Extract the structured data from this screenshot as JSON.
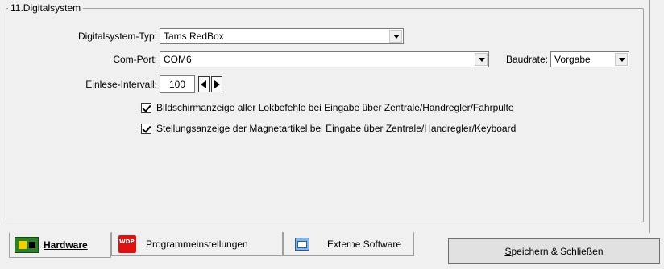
{
  "groupbox": {
    "title": "11.Digitalsystem"
  },
  "fields": {
    "digitalsystem_label": "Digitalsystem-Typ:",
    "digitalsystem_value": "Tams RedBox",
    "comport_label": "Com-Port:",
    "comport_value": "COM6",
    "baudrate_label": "Baudrate:",
    "baudrate_value": "Vorgabe",
    "interval_label": "Einlese-Intervall:",
    "interval_value": "100"
  },
  "checkboxes": [
    {
      "label": "Bildschirmanzeige aller Lokbefehle bei Eingabe über Zentrale/Handregler/Fahrpulte",
      "checked": true
    },
    {
      "label": "Stellungsanzeige der Magnetartikel bei Eingabe über Zentrale/Handregler/Keyboard",
      "checked": true
    }
  ],
  "tabs": [
    {
      "label": "Hardware",
      "icon": "hardware-icon",
      "active": true
    },
    {
      "label": "Programmeinstellungen",
      "icon": "wdp-icon",
      "active": false
    },
    {
      "label": "Externe Software",
      "icon": "external-software-icon",
      "active": false
    }
  ],
  "save_button": {
    "label_underlined": "S",
    "label_rest": "peichern & Schließen"
  }
}
